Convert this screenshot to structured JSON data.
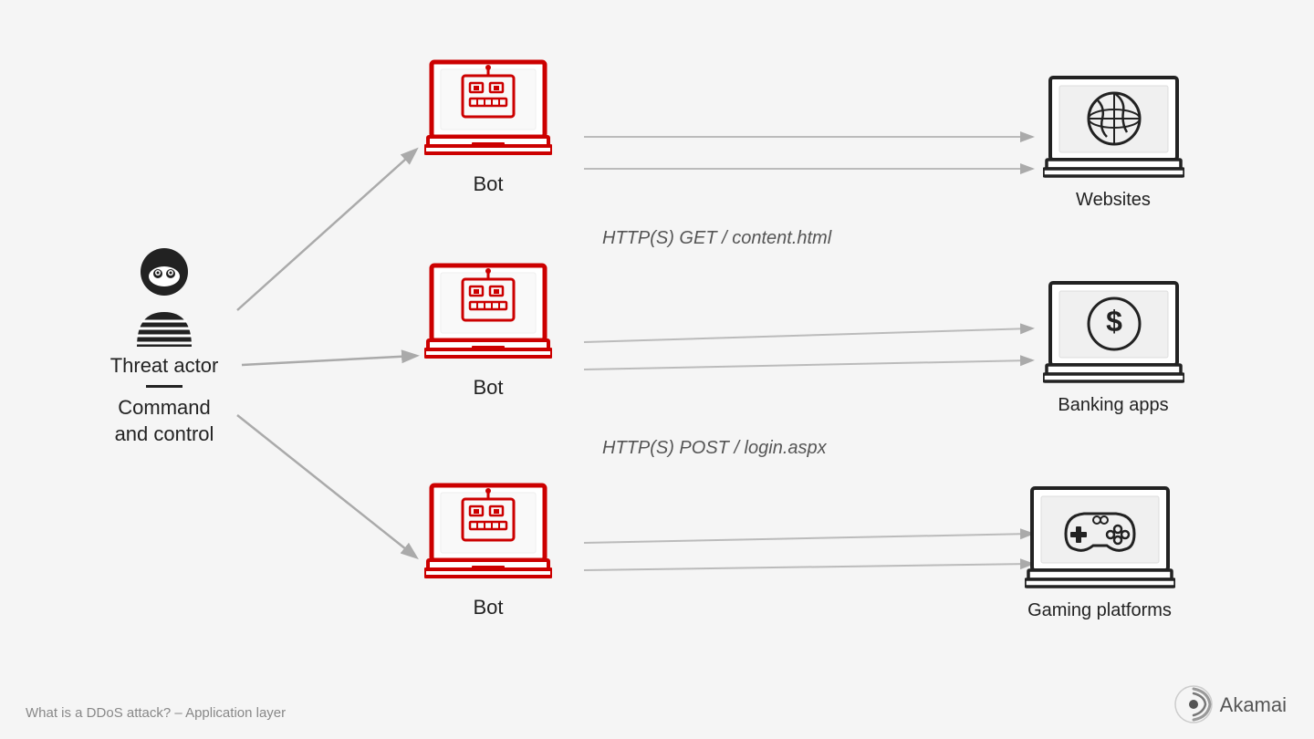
{
  "title": "What is a DDoS attack? – Application layer",
  "brand": "Akamai",
  "threatActor": {
    "label": "Threat actor",
    "sublabel": "Command\nand control"
  },
  "bots": [
    {
      "id": "bot1",
      "label": "Bot"
    },
    {
      "id": "bot2",
      "label": "Bot"
    },
    {
      "id": "bot3",
      "label": "Bot"
    }
  ],
  "targets": [
    {
      "id": "target1",
      "label": "Websites"
    },
    {
      "id": "target2",
      "label": "Banking apps"
    },
    {
      "id": "target3",
      "label": "Gaming platforms"
    }
  ],
  "httpLabels": [
    {
      "id": "http1",
      "text": "HTTP(S) GET / content.html"
    },
    {
      "id": "http2",
      "text": "HTTP(S) POST / login.aspx"
    }
  ],
  "colors": {
    "red": "#cc0000",
    "dark": "#222222",
    "gray": "#aaaaaa",
    "lightGray": "#cccccc"
  }
}
